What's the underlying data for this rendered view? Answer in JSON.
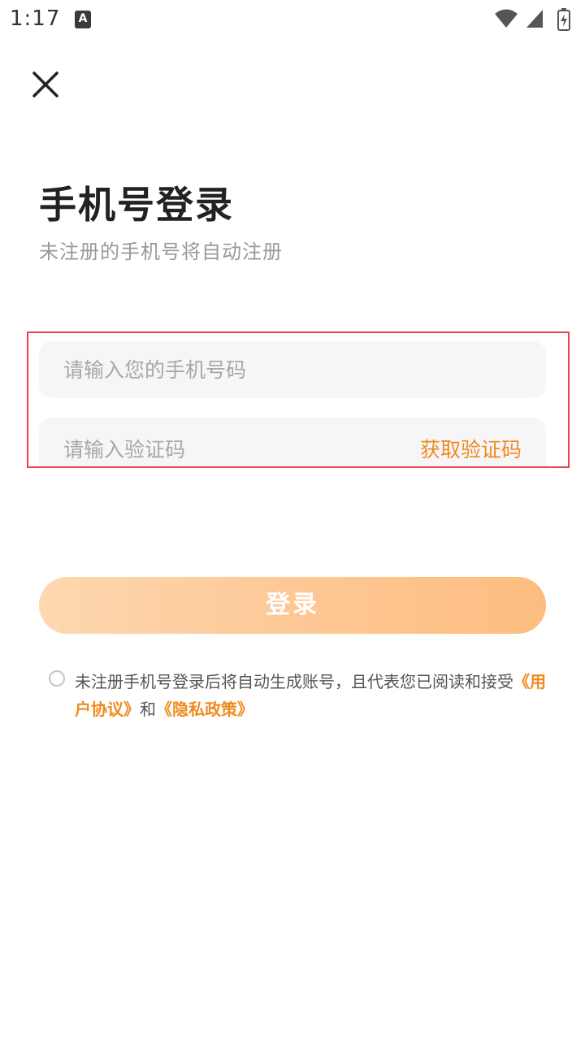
{
  "status_bar": {
    "time": "1:17",
    "notification_icon": "A",
    "icons": [
      "wifi-icon",
      "cell-signal-icon",
      "battery-charging-icon"
    ]
  },
  "header": {
    "close_icon": "close-icon"
  },
  "title": "手机号登录",
  "subtitle": "未注册的手机号将自动注册",
  "phone_input": {
    "placeholder": "请输入您的手机号码",
    "value": ""
  },
  "code_input": {
    "placeholder": "请输入验证码",
    "value": ""
  },
  "get_code_label": "获取验证码",
  "login_label": "登录",
  "agreement": {
    "text": "未注册手机号登录后将自动生成账号，且代表您已阅读和接受",
    "user_agreement": "《用户协议》",
    "conjunction": "和",
    "privacy_policy": "《隐私政策》",
    "checked": false
  },
  "colors": {
    "accent": "#f08a1c",
    "button_gradient_start": "#fdd8b0",
    "button_gradient_end": "#fdbd7f",
    "highlight_border": "#e8424f",
    "input_bg": "#f6f6f8"
  }
}
